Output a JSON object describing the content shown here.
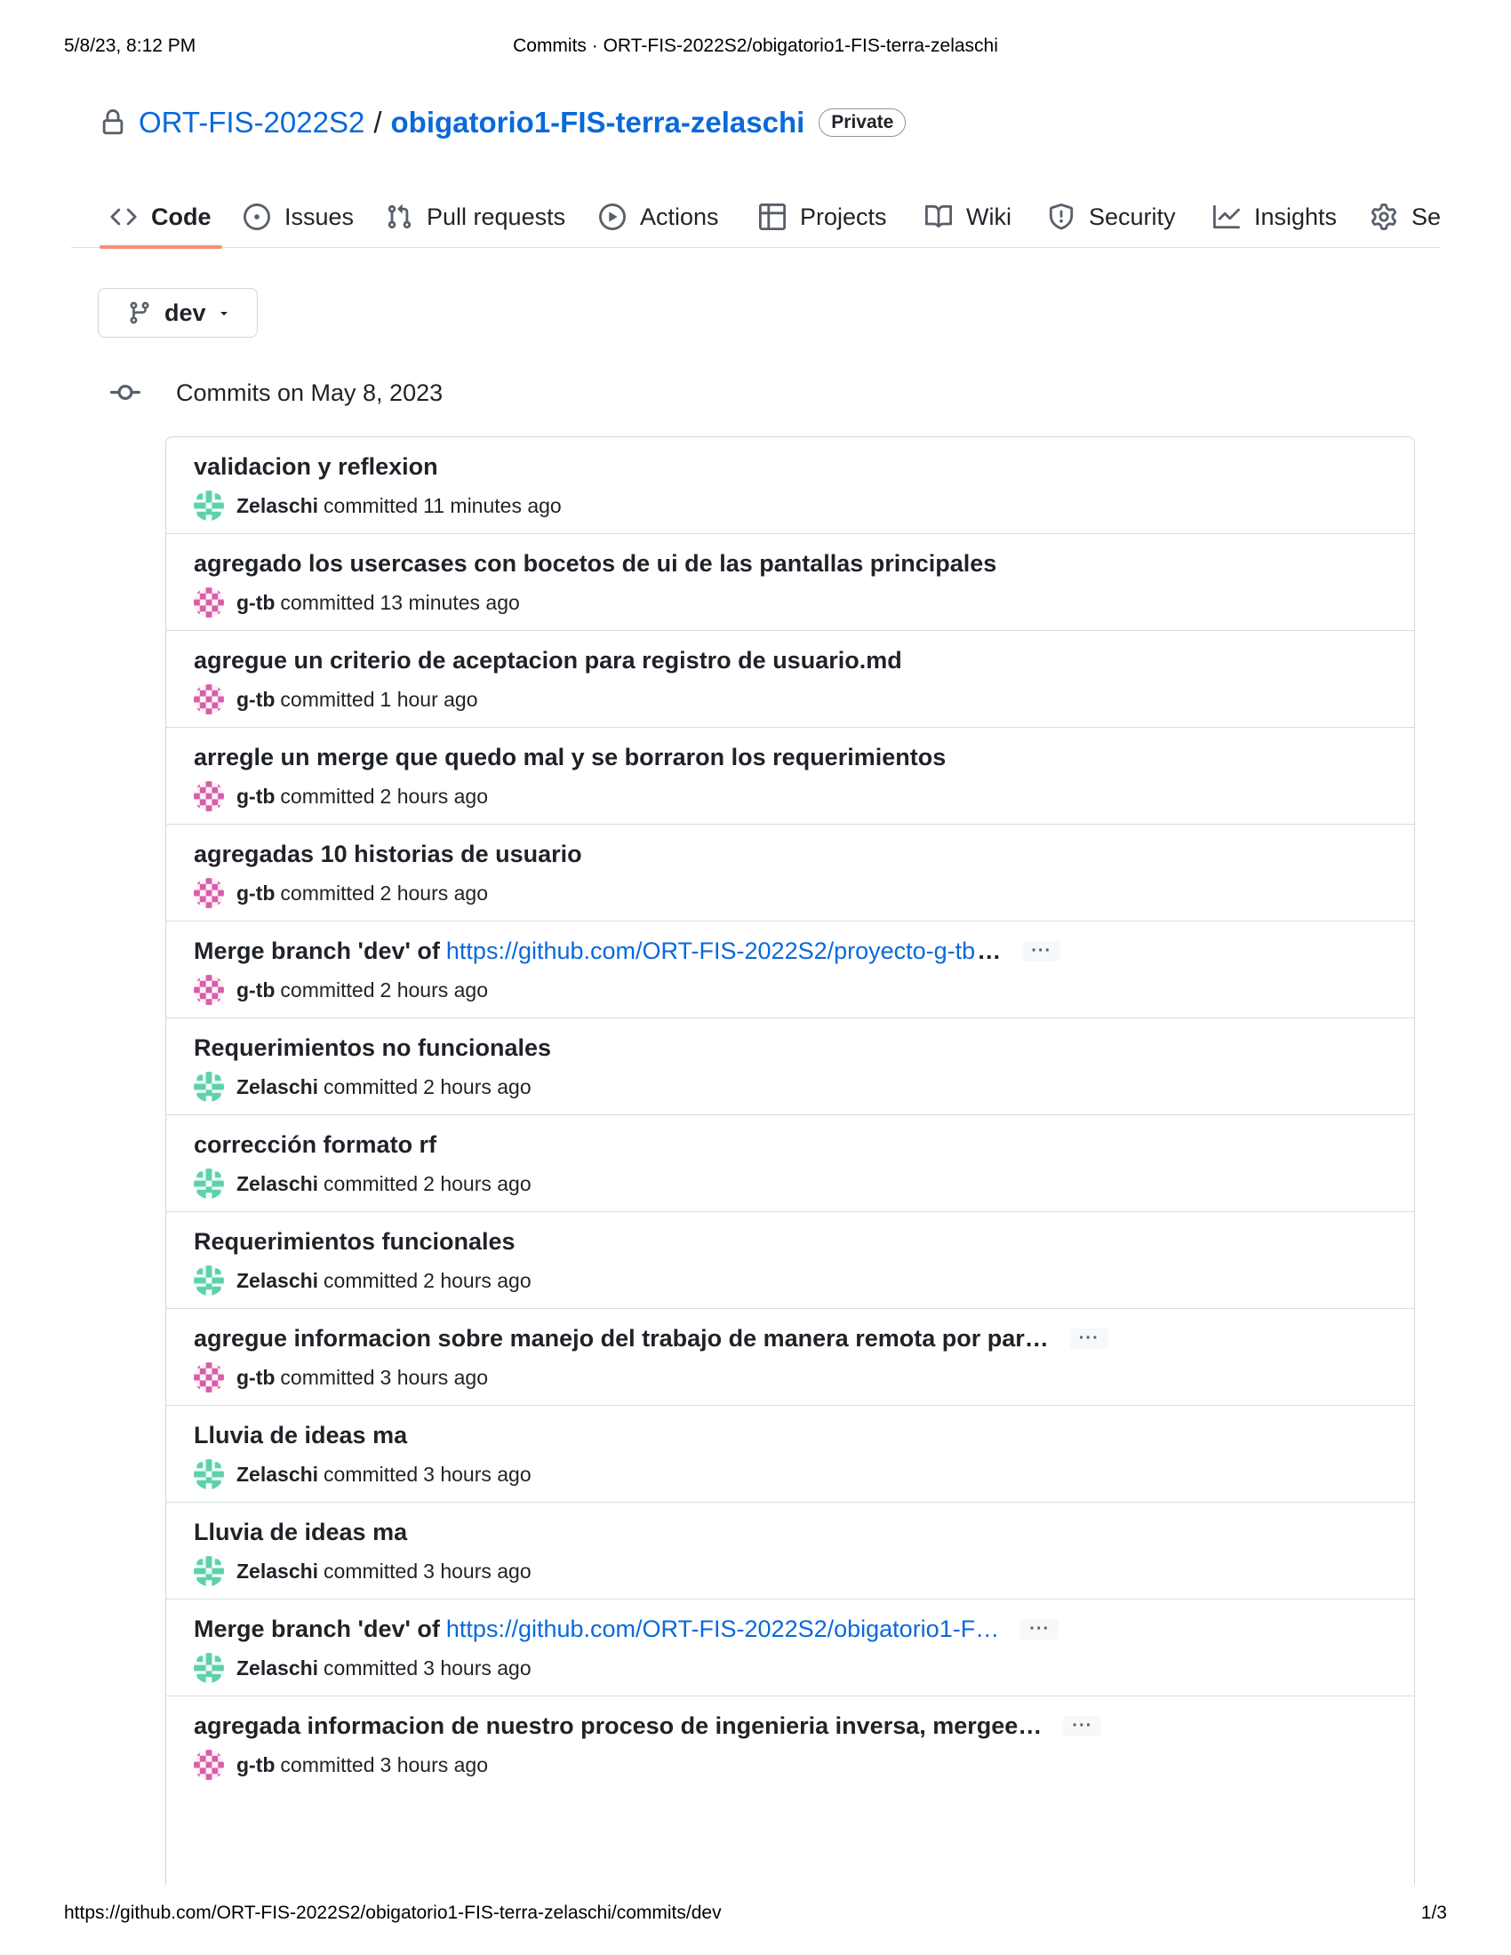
{
  "print": {
    "date": "5/8/23, 8:12 PM",
    "page_title": "Commits · ORT-FIS-2022S2/obigatorio1-FIS-terra-zelaschi",
    "url": "https://github.com/ORT-FIS-2022S2/obigatorio1-FIS-terra-zelaschi/commits/dev",
    "page_number": "1/3"
  },
  "repo": {
    "owner": "ORT-FIS-2022S2",
    "separator": "/",
    "name": "obigatorio1-FIS-terra-zelaschi",
    "visibility": "Private"
  },
  "tabs": [
    {
      "label": "Code",
      "icon": "code-icon",
      "active": true
    },
    {
      "label": "Issues",
      "icon": "issue-icon",
      "active": false
    },
    {
      "label": "Pull requests",
      "icon": "pull-request-icon",
      "active": false
    },
    {
      "label": "Actions",
      "icon": "play-icon",
      "active": false
    },
    {
      "label": "Projects",
      "icon": "table-icon",
      "active": false
    },
    {
      "label": "Wiki",
      "icon": "book-icon",
      "active": false
    },
    {
      "label": "Security",
      "icon": "shield-icon",
      "active": false
    },
    {
      "label": "Insights",
      "icon": "graph-icon",
      "active": false
    },
    {
      "label": "Se",
      "icon": "gear-icon",
      "active": false
    }
  ],
  "branch": {
    "name": "dev"
  },
  "commits_header": "Commits on May 8, 2023",
  "colors": {
    "link": "#0969da",
    "zelaschi_avatar": "#5fd1a8",
    "gtb_avatar": "#d560a8"
  },
  "commits": [
    {
      "title": "validacion y reflexion",
      "link": "",
      "title_suffix": "",
      "author": "Zelaschi",
      "action": "committed",
      "time": "11 minutes ago",
      "truncated": false
    },
    {
      "title": "agregado los usercases con bocetos de ui de las pantallas principales",
      "link": "",
      "title_suffix": "",
      "author": "g-tb",
      "action": "committed",
      "time": "13 minutes ago",
      "truncated": false
    },
    {
      "title": "agregue un criterio de aceptacion para registro de usuario.md",
      "link": "",
      "title_suffix": "",
      "author": "g-tb",
      "action": "committed",
      "time": "1 hour ago",
      "truncated": false
    },
    {
      "title": "arregle un merge que quedo mal y se borraron los requerimientos",
      "link": "",
      "title_suffix": "",
      "author": "g-tb",
      "action": "committed",
      "time": "2 hours ago",
      "truncated": false
    },
    {
      "title": "agregadas 10 historias de usuario",
      "link": "",
      "title_suffix": "",
      "author": "g-tb",
      "action": "committed",
      "time": "2 hours ago",
      "truncated": false
    },
    {
      "title": "Merge branch 'dev' of",
      "link": "https://github.com/ORT-FIS-2022S2/proyecto-g-tb",
      "title_suffix": "…",
      "author": "g-tb",
      "action": "committed",
      "time": "2 hours ago",
      "truncated": true
    },
    {
      "title": "Requerimientos no funcionales",
      "link": "",
      "title_suffix": "",
      "author": "Zelaschi",
      "action": "committed",
      "time": "2 hours ago",
      "truncated": false
    },
    {
      "title": "corrección formato rf",
      "link": "",
      "title_suffix": "",
      "author": "Zelaschi",
      "action": "committed",
      "time": "2 hours ago",
      "truncated": false
    },
    {
      "title": "Requerimientos funcionales",
      "link": "",
      "title_suffix": "",
      "author": "Zelaschi",
      "action": "committed",
      "time": "2 hours ago",
      "truncated": false
    },
    {
      "title": "agregue informacion sobre manejo del trabajo de manera remota por par…",
      "link": "",
      "title_suffix": "",
      "author": "g-tb",
      "action": "committed",
      "time": "3 hours ago",
      "truncated": true
    },
    {
      "title": "Lluvia de ideas ma",
      "link": "",
      "title_suffix": "",
      "author": "Zelaschi",
      "action": "committed",
      "time": "3 hours ago",
      "truncated": false
    },
    {
      "title": "Lluvia de ideas ma",
      "link": "",
      "title_suffix": "",
      "author": "Zelaschi",
      "action": "committed",
      "time": "3 hours ago",
      "truncated": false
    },
    {
      "title": "Merge branch 'dev' of",
      "link": "https://github.com/ORT-FIS-2022S2/obigatorio1-F…",
      "title_suffix": "",
      "author": "Zelaschi",
      "action": "committed",
      "time": "3 hours ago",
      "truncated": true
    },
    {
      "title": "agregada informacion de nuestro proceso de ingenieria inversa, mergee…",
      "link": "",
      "title_suffix": "",
      "author": "g-tb",
      "action": "committed",
      "time": "3 hours ago",
      "truncated": true
    }
  ],
  "more_label": "···"
}
